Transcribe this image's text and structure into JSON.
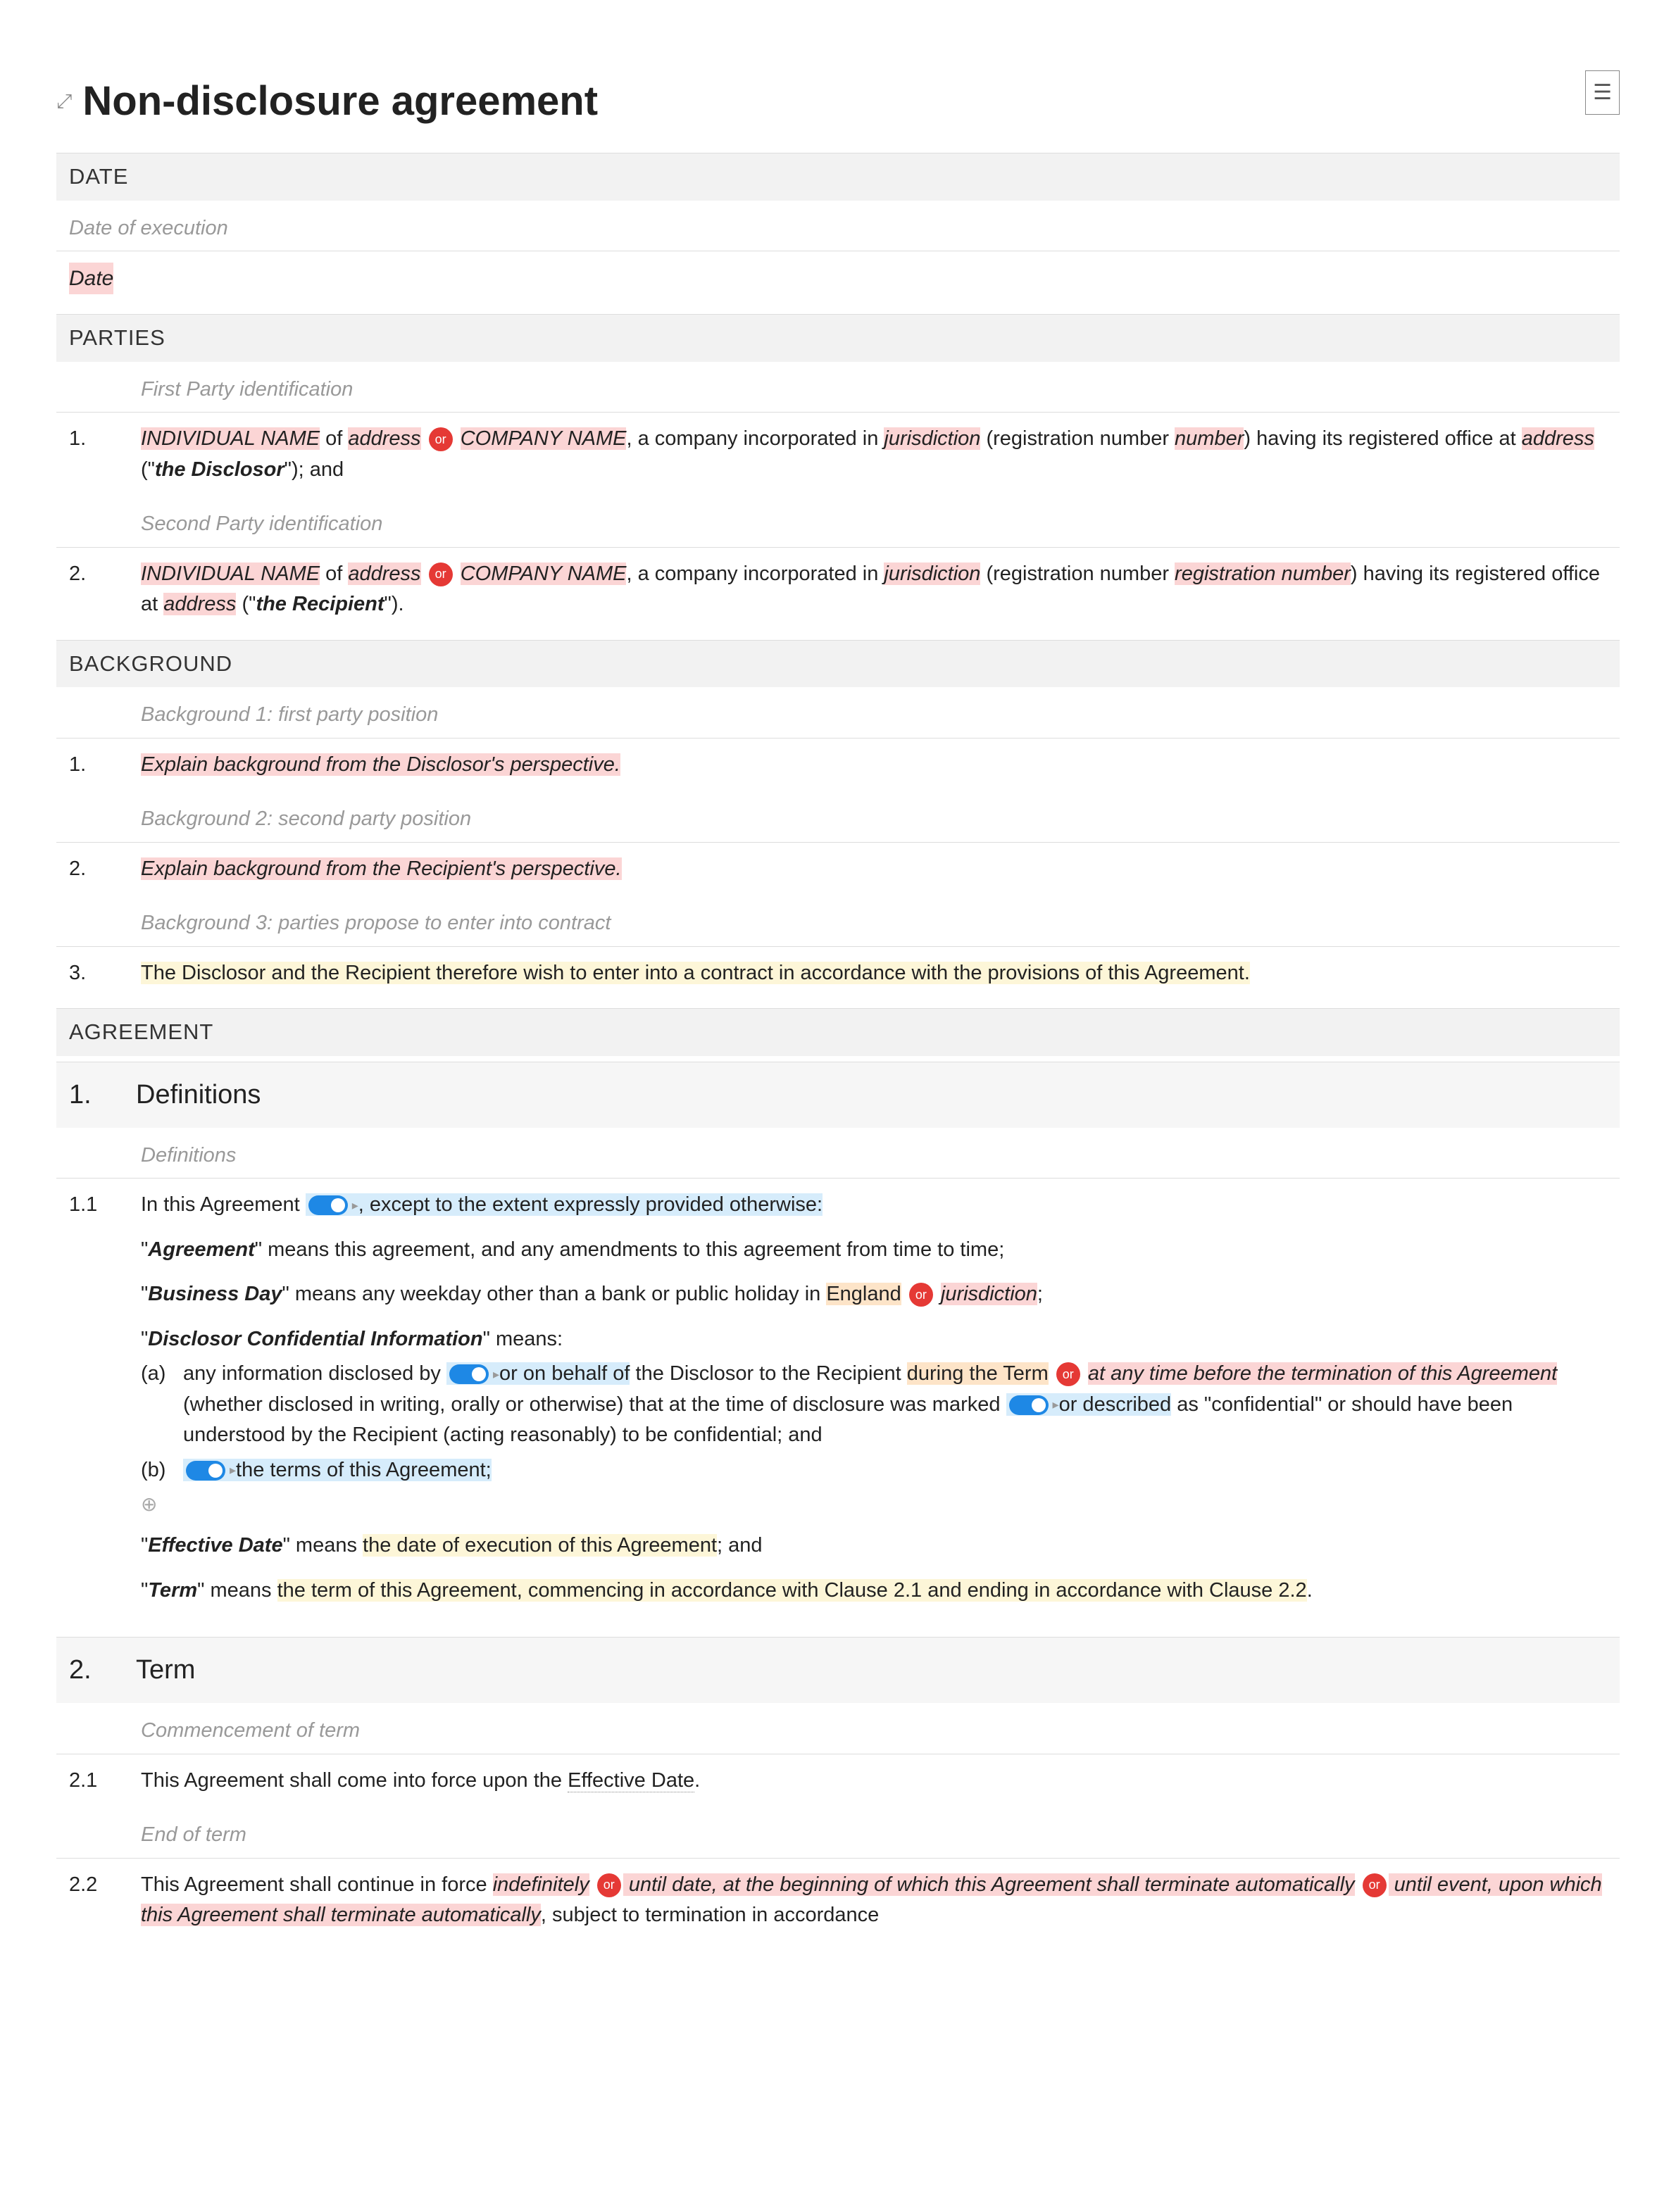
{
  "title": "Non-disclosure agreement",
  "date_heading": "DATE",
  "date_note": "Date of execution",
  "date_placeholder": "Date",
  "parties_heading": "PARTIES",
  "party1_note": "First Party identification",
  "party1_num": "1.",
  "p1_indiv": "INDIVIDUAL NAME",
  "p1_of": " of ",
  "p1_addr": "address",
  "or_label": "or",
  "p1_company": "COMPANY NAME",
  "p1_text1": ", a company incorporated in ",
  "p1_juris": "jurisdiction",
  "p1_text2": " (registration number ",
  "p1_number": "number",
  "p1_text3": ") having its registered office at ",
  "p1_addr2": "address",
  "p1_text4": " (\"",
  "p1_role": "the Disclosor",
  "p1_text5": "\"); and",
  "party2_note": "Second Party identification",
  "party2_num": "2.",
  "p2_indiv": "INDIVIDUAL NAME",
  "p2_company": "COMPANY NAME",
  "p2_juris": "jurisdiction",
  "p2_regnum": "registration number",
  "p2_addr2": "address",
  "p2_role": "the Recipient",
  "p2_close": "\").",
  "bg_heading": "BACKGROUND",
  "bg1_note": "Background 1: first party position",
  "bg1_num": "1.",
  "bg1_text": "Explain background from the Disclosor's perspective.",
  "bg2_note": "Background 2: second party position",
  "bg2_num": "2.",
  "bg2_text": "Explain background from the Recipient's perspective.",
  "bg3_note": "Background 3: parties propose to enter into contract",
  "bg3_num": "3.",
  "bg3_text": "The Disclosor and the Recipient therefore wish to enter into a contract in accordance with the provisions of this Agreement.",
  "agreement_heading": "AGREEMENT",
  "s1_num": "1.",
  "s1_title": "Definitions",
  "s1_note": "Definitions",
  "s11_num": "1.1",
  "s11_intro1": "In this Agreement",
  "s11_intro2": ", except to the extent expressly provided otherwise:",
  "def_agreement_term": "Agreement",
  "def_agreement_text": "\" means this agreement, and any amendments to this agreement from time to time;",
  "def_bd_term": "Business Day",
  "def_bd_text1": "\" means any weekday other than a bank or public holiday in ",
  "def_bd_england": "England",
  "def_bd_juris": "jurisdiction",
  "def_dci_term": "Disclosor Confidential Information",
  "def_dci_means": "\" means:",
  "dci_a": "(a)",
  "dci_a_1": "any information disclosed by ",
  "dci_a_2": "or on behalf of",
  "dci_a_3": " the Disclosor to the Recipient ",
  "dci_a_4": "during the Term",
  "dci_a_5": "at any time before the termination of this Agreement",
  "dci_a_6": " (whether disclosed in writing, orally or otherwise) that at the time of disclosure was marked ",
  "dci_a_7": "or described",
  "dci_a_8": " as \"confidential\" or should have been understood by the Recipient (acting reasonably) to be confidential; and",
  "dci_b": "(b)",
  "dci_b_text": "the terms of this Agreement;",
  "def_ed_term": "Effective Date",
  "def_ed_text1": "\" means ",
  "def_ed_text2": "the date of execution of this Agreement",
  "def_ed_text3": "; and",
  "def_term_term": "Term",
  "def_term_text1": "\" means ",
  "def_term_text2": "the term of this Agreement, commencing in accordance with Clause 2.1 and ending in accordance with Clause 2.2",
  "def_term_text3": ".",
  "s2_num": "2.",
  "s2_title": "Term",
  "s21_note": "Commencement of term",
  "s21_num": "2.1",
  "s21_text1": "This Agreement shall come into force upon the ",
  "s21_text2": "Effective Date",
  "s21_text3": ".",
  "s22_note": "End of term",
  "s22_num": "2.2",
  "s22_t1": "This Agreement shall continue in force ",
  "s22_indef": "indefinitely",
  "s22_until": " until ",
  "s22_date": "date",
  "s22_t2": ", at the beginning of which this Agreement shall terminate automatically",
  "s22_until2": " until ",
  "s22_event": "event",
  "s22_t3": ", upon which this Agreement shall terminate automatically",
  "s22_t4": ", subject to termination in accordance"
}
